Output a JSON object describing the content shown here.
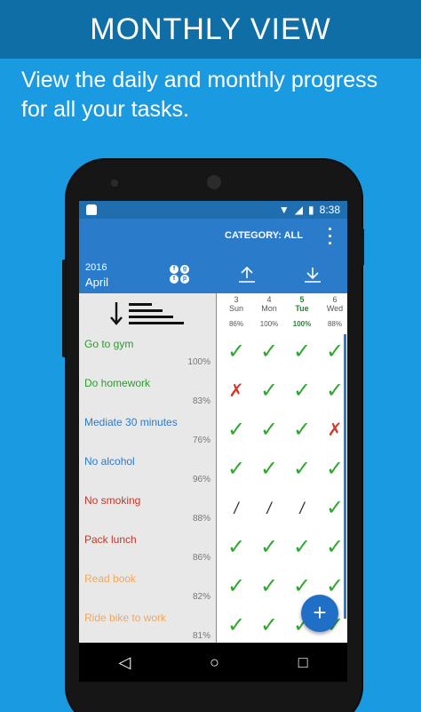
{
  "banner": {
    "title": "MONTHLY VIEW"
  },
  "subtitle": {
    "line1": "View the daily and monthly progress",
    "line2": "for all your tasks."
  },
  "status": {
    "time": "8:38"
  },
  "appbar": {
    "category": "CATEGORY: ALL"
  },
  "date": {
    "year": "2016",
    "month": "April"
  },
  "days": [
    {
      "num": "3",
      "name": "Sun",
      "pct": "86%"
    },
    {
      "num": "4",
      "name": "Mon",
      "pct": "100%"
    },
    {
      "num": "5",
      "name": "Tue",
      "pct": "100%"
    },
    {
      "num": "6",
      "name": "Wed",
      "pct": "88%"
    }
  ],
  "tasks": [
    {
      "name": "Go to gym",
      "pct": "100%",
      "color": "#2e9a2e",
      "marks": [
        "check",
        "check",
        "check",
        "check"
      ]
    },
    {
      "name": "Do homework",
      "pct": "83%",
      "color": "#2e9a2e",
      "marks": [
        "cross",
        "check",
        "check",
        "check"
      ]
    },
    {
      "name": "Mediate 30 minutes",
      "pct": "76%",
      "color": "#2b7bcb",
      "marks": [
        "check",
        "check",
        "check",
        "cross"
      ]
    },
    {
      "name": "No alcohol",
      "pct": "96%",
      "color": "#2b7bcb",
      "marks": [
        "check",
        "check",
        "check",
        "check"
      ]
    },
    {
      "name": "No smoking",
      "pct": "88%",
      "color": "#c0392b",
      "marks": [
        "skip",
        "skip",
        "skip",
        "check"
      ]
    },
    {
      "name": "Pack lunch",
      "pct": "86%",
      "color": "#c0392b",
      "marks": [
        "check",
        "check",
        "check",
        "check"
      ]
    },
    {
      "name": "Read book",
      "pct": "82%",
      "color": "#f0a860",
      "marks": [
        "check",
        "check",
        "check",
        "check"
      ]
    },
    {
      "name": "Ride bike to work",
      "pct": "81%",
      "color": "#f0a860",
      "marks": [
        "check",
        "check",
        "check",
        "check"
      ]
    }
  ],
  "glyphs": {
    "check": "✓",
    "cross": "✗",
    "skip": "/"
  },
  "fab": {
    "label": "+"
  },
  "nav": {
    "back": "◁",
    "home": "○",
    "recents": "□"
  }
}
